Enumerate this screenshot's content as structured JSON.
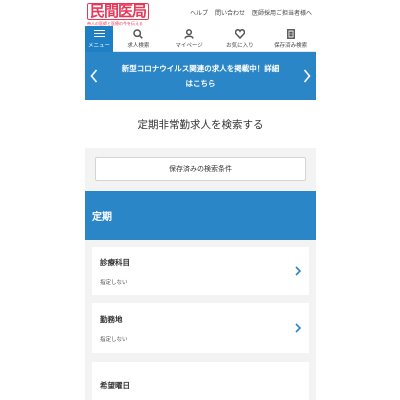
{
  "header": {
    "logo_text": "民間医局",
    "logo_tagline": "帝人の医師と医療の今を伝える",
    "links": [
      "ヘルプ",
      "問い合わせ",
      "医師採用ご担当者様へ"
    ]
  },
  "nav": {
    "menu_label": "メニュー",
    "items": [
      {
        "label": "求人検索",
        "icon": "search-icon"
      },
      {
        "label": "マイページ",
        "icon": "user-icon"
      },
      {
        "label": "お気に入り",
        "icon": "heart-icon"
      },
      {
        "label": "保存済み検索",
        "icon": "document-icon"
      }
    ]
  },
  "banner": {
    "line1": "新型コロナウイルス関連の求人を掲載中！詳細",
    "line2": "はこちら"
  },
  "search": {
    "title": "定期非常勤求人を検索する",
    "saved_button": "保存済みの検索条件"
  },
  "section": {
    "title": "定期"
  },
  "filters": [
    {
      "title": "診療科目",
      "value": "指定しない"
    },
    {
      "title": "勤務地",
      "value": "指定しない"
    },
    {
      "title": "希望曜日",
      "value": ""
    }
  ],
  "colors": {
    "brand": "#e8385a",
    "accent": "#2b86c8",
    "menu": "#1f7fc4"
  }
}
